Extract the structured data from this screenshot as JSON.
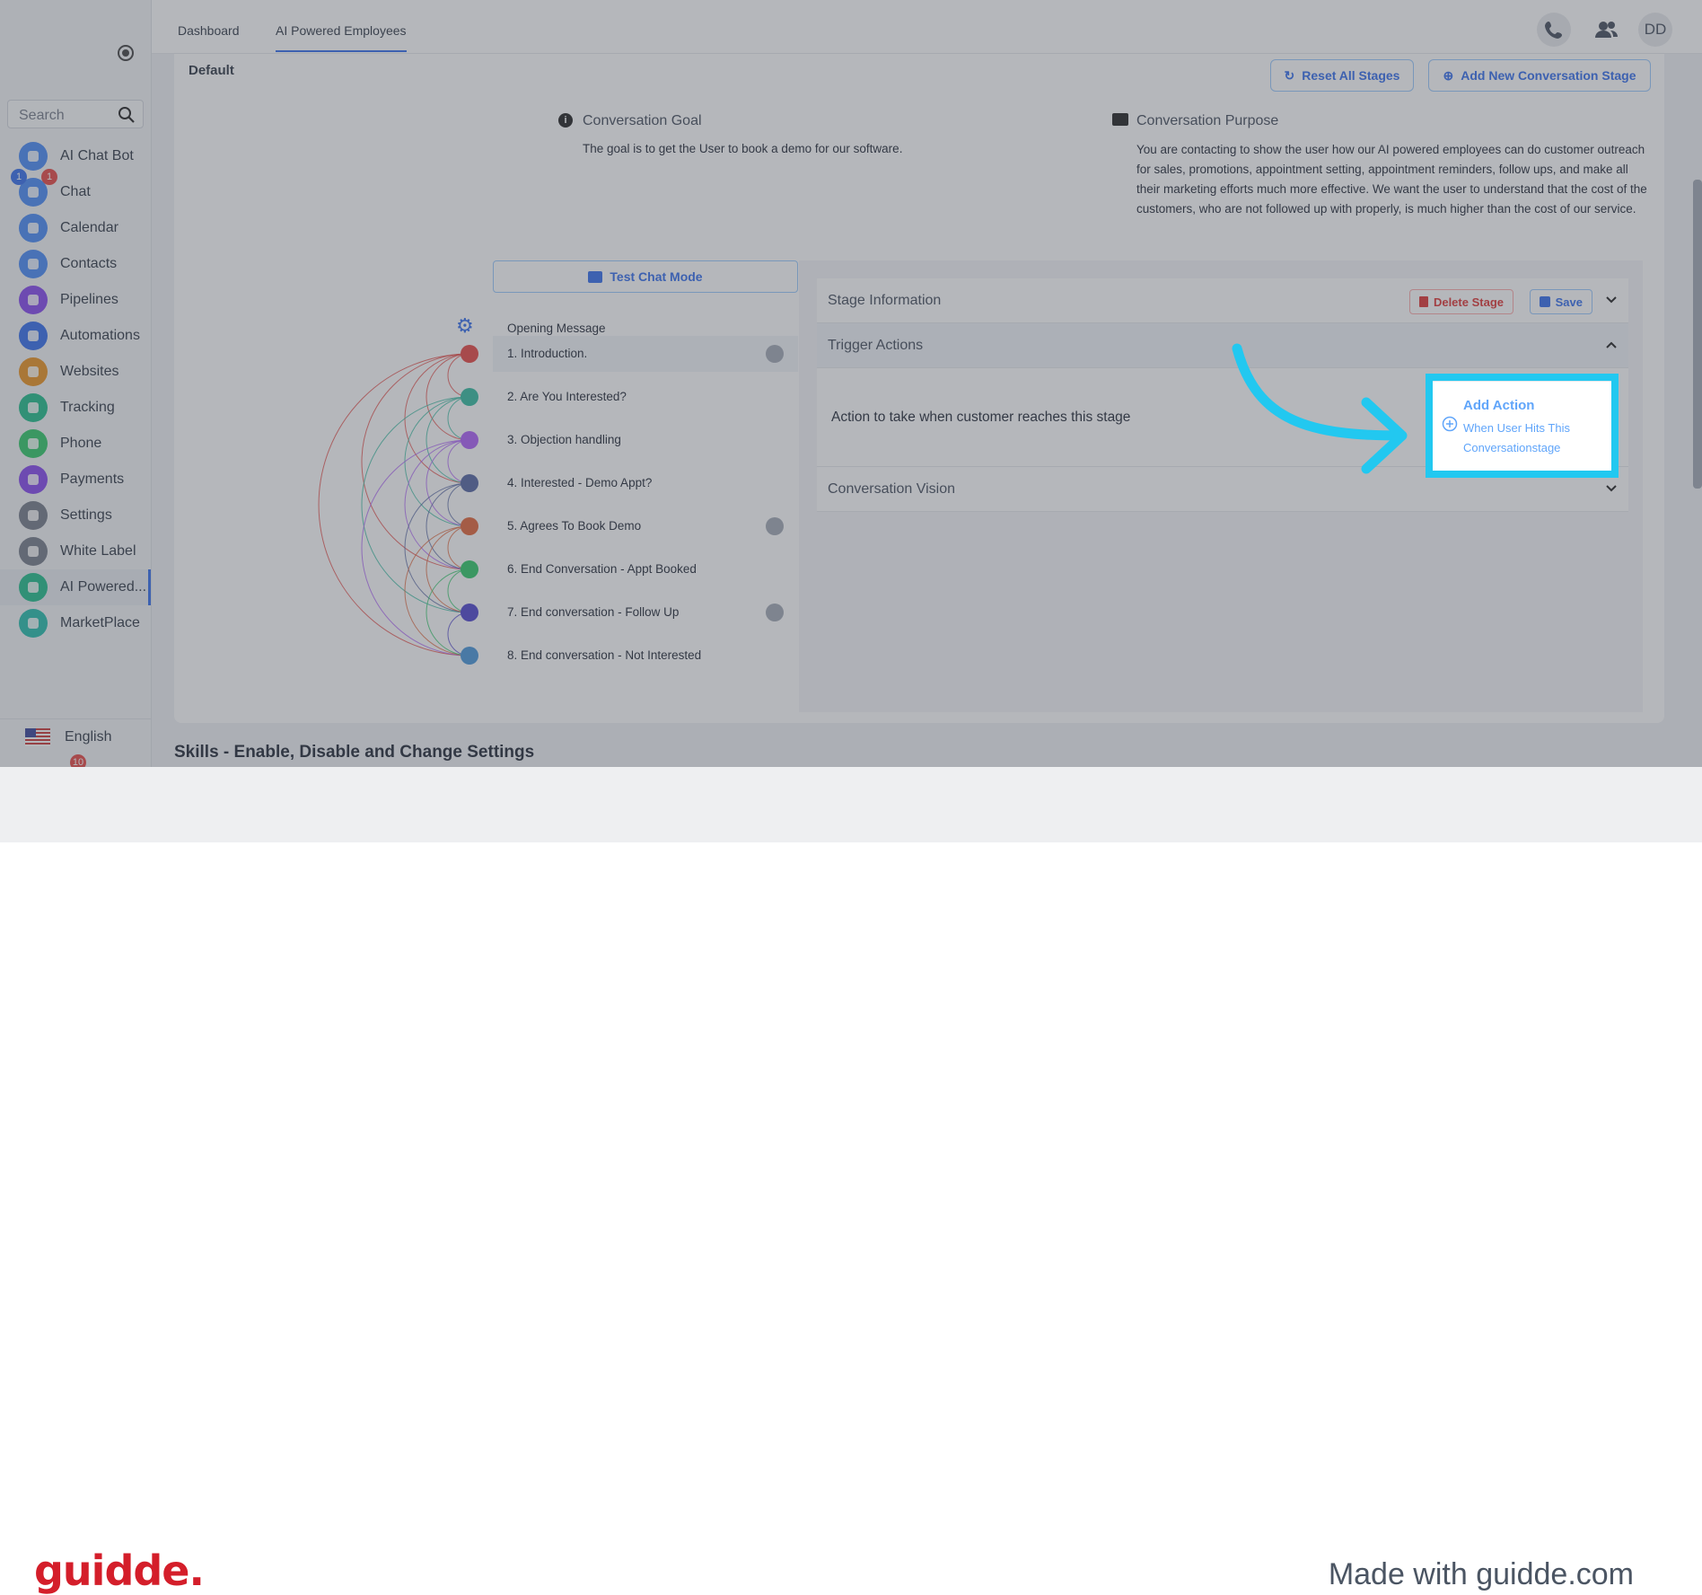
{
  "topbar": {
    "tabs": [
      "Dashboard",
      "AI Powered Employees"
    ],
    "avatar": "DD"
  },
  "sidebar": {
    "search_placeholder": "Search",
    "items": [
      {
        "label": "AI Chat Bot",
        "color": "#3b82f6"
      },
      {
        "label": "Chat",
        "color": "#3b82f6"
      },
      {
        "label": "Calendar",
        "color": "#3b82f6"
      },
      {
        "label": "Contacts",
        "color": "#3b82f6"
      },
      {
        "label": "Pipelines",
        "color": "#7c3aed"
      },
      {
        "label": "Automations",
        "color": "#2563eb"
      },
      {
        "label": "Websites",
        "color": "#ea8a10"
      },
      {
        "label": "Tracking",
        "color": "#10b981"
      },
      {
        "label": "Phone",
        "color": "#22c55e"
      },
      {
        "label": "Payments",
        "color": "#7c3aed"
      },
      {
        "label": "Settings",
        "color": "#6b7280"
      },
      {
        "label": "White Label",
        "color": "#6b7280"
      },
      {
        "label": "AI Powered...",
        "color": "#10b981"
      },
      {
        "label": "MarketPlace",
        "color": "#14b8a6"
      }
    ],
    "chat_badge_blue": "1",
    "chat_badge_red": "1",
    "language": "English",
    "bottom_badge": "10"
  },
  "card": {
    "title": "Default",
    "reset_label": "Reset All Stages",
    "add_stage_label": "Add New Conversation Stage",
    "goal_title": "Conversation Goal",
    "goal_text": "The goal is to get the User to book a demo for our software.",
    "purpose_title": "Conversation Purpose",
    "purpose_text": "You are contacting to show the user how our AI powered employees can do customer outreach for sales, promotions, appointment setting, appointment reminders, follow ups, and make all their marketing efforts much more effective. We want the user to understand that the cost of the customers, who are not followed up with properly, is much higher than the cost of our service."
  },
  "stages": {
    "test_label": "Test Chat Mode",
    "opening": "Opening Message",
    "items": [
      {
        "label": "1. Introduction.",
        "color": "#e53935"
      },
      {
        "label": "2. Are You Interested?",
        "color": "#26b79a"
      },
      {
        "label": "3. Objection handling",
        "color": "#a855f7"
      },
      {
        "label": "4. Interested - Demo Appt?",
        "color": "#475a9b"
      },
      {
        "label": "5. Agrees To Book Demo",
        "color": "#e05a2a"
      },
      {
        "label": "6. End Conversation - Appt Booked",
        "color": "#22c55e"
      },
      {
        "label": "7. End conversation - Follow Up",
        "color": "#4338ca"
      },
      {
        "label": "8. End conversation - Not Interested",
        "color": "#3b8fd8"
      }
    ]
  },
  "panel": {
    "stage_info": "Stage Information",
    "delete_label": "Delete Stage",
    "save_label": "Save",
    "trigger": "Trigger Actions",
    "action_text": "Action to take when customer reaches this stage",
    "add_action": "Add Action",
    "add_action_sub": "When User Hits This Conversationstage",
    "vision": "Conversation Vision"
  },
  "skills_title": "Skills - Enable, Disable and Change Settings",
  "footer": {
    "brand": "guidde.",
    "made": "Made with guidde.com"
  },
  "colors": {
    "highlight": "#22c8f0",
    "accent": "#2563eb"
  }
}
